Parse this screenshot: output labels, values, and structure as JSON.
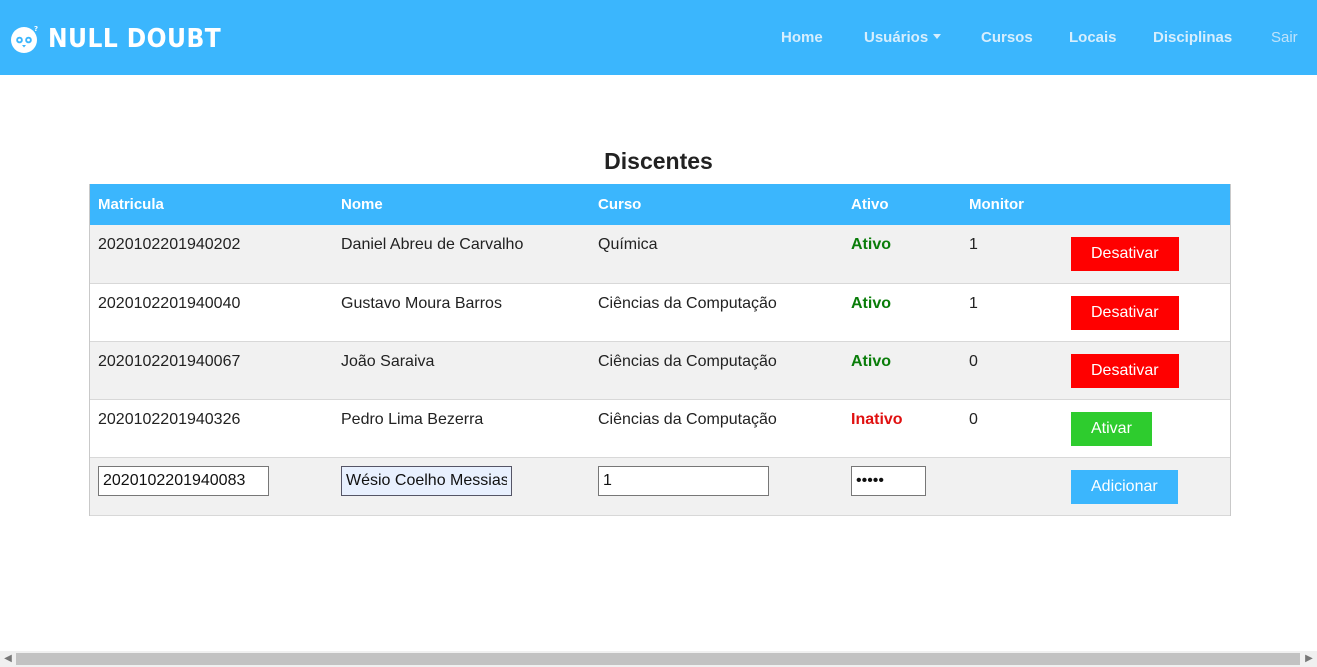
{
  "brand": {
    "name": "NULL DOUBT"
  },
  "nav": {
    "home": "Home",
    "usuarios": "Usuários",
    "cursos": "Cursos",
    "locais": "Locais",
    "disciplinas": "Disciplinas",
    "sair": "Sair"
  },
  "page": {
    "title": "Discentes"
  },
  "table": {
    "headers": [
      "Matricula",
      "Nome",
      "Curso",
      "Ativo",
      "Monitor"
    ],
    "rows": [
      {
        "matricula": "2020102201940202",
        "nome": "Daniel Abreu de Carvalho",
        "curso": "Química",
        "ativo": "Ativo",
        "monitor": "1",
        "action": "Desativar"
      },
      {
        "matricula": "2020102201940040",
        "nome": "Gustavo Moura Barros",
        "curso": "Ciências da Computação",
        "ativo": "Ativo",
        "monitor": "1",
        "action": "Desativar"
      },
      {
        "matricula": "2020102201940067",
        "nome": "João Saraiva",
        "curso": "Ciências da Computação",
        "ativo": "Ativo",
        "monitor": "0",
        "action": "Desativar"
      },
      {
        "matricula": "2020102201940326",
        "nome": "Pedro Lima Bezerra",
        "curso": "Ciências da Computação",
        "ativo": "Inativo",
        "monitor": "0",
        "action": "Ativar"
      }
    ],
    "new_row": {
      "matricula_value": "2020102201940083",
      "nome_value": "Wésio Coelho Messias",
      "curso_value": "1",
      "senha_value": "12345",
      "add_label": "Adicionar"
    }
  },
  "colors": {
    "brand_blue": "#3bb6fd",
    "active_green": "#0a7d0a",
    "inactive_red": "#e01010",
    "deactivate_button": "#ff0000",
    "activate_button": "#2ecc2e"
  }
}
